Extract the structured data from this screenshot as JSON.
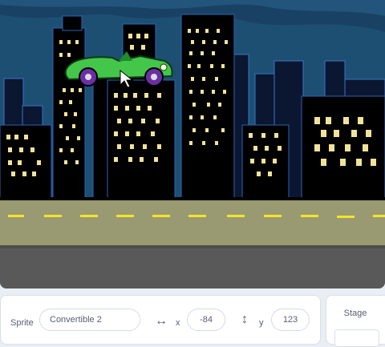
{
  "sprite_info": {
    "sprite_label": "Sprite",
    "sprite_name": "Convertible 2",
    "x_label": "x",
    "x_value": "-84",
    "y_label": "y",
    "y_value": "123"
  },
  "stage_panel": {
    "title": "Stage"
  },
  "icons": {
    "x_axis": "horizontal-arrows-icon",
    "y_axis": "vertical-arrows-icon",
    "cursor": "mouse-pointer-icon"
  },
  "colors": {
    "sky": "#1d4f73",
    "building": "#000000",
    "window": "#f1e39b",
    "road_shoulder": "#9a9a72",
    "road": "#595959",
    "lane_mark": "#f2e52b",
    "car": "#44c64a"
  }
}
